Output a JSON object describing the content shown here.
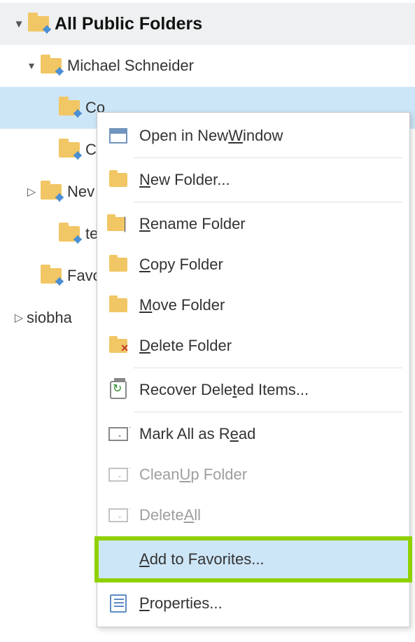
{
  "tree": {
    "root": "All Public Folders",
    "nodes": [
      {
        "label": "Michael Schneider",
        "level": 1,
        "arrow": "down"
      },
      {
        "label": "Co",
        "level": 2,
        "selected": true
      },
      {
        "label": "Co",
        "level": 2
      },
      {
        "label": "Nev",
        "level": 1,
        "arrow": "right"
      },
      {
        "label": "test",
        "level": 2
      },
      {
        "label": "Favo",
        "level": 1
      },
      {
        "label": "siobha",
        "level": 0,
        "arrow": "right",
        "plain": true
      }
    ]
  },
  "menu": {
    "items": [
      {
        "id": "open-new-window",
        "pre": "Open in New ",
        "u": "W",
        "post": "indow",
        "icon": "window"
      },
      {
        "id": "new-folder",
        "pre": "",
        "u": "N",
        "post": "ew Folder...",
        "icon": "folder",
        "sepBefore": true
      },
      {
        "id": "rename-folder",
        "pre": "",
        "u": "R",
        "post": "ename Folder",
        "icon": "folder-cursor",
        "sepBefore": true
      },
      {
        "id": "copy-folder",
        "pre": "",
        "u": "C",
        "post": "opy Folder",
        "icon": "folder"
      },
      {
        "id": "move-folder",
        "pre": "",
        "u": "M",
        "post": "ove Folder",
        "icon": "folder"
      },
      {
        "id": "delete-folder",
        "pre": "",
        "u": "D",
        "post": "elete Folder",
        "icon": "folder-x"
      },
      {
        "id": "recover-deleted",
        "pre": "Recover Dele",
        "u": "t",
        "post": "ed Items...",
        "icon": "recycle",
        "sepBefore": true
      },
      {
        "id": "mark-read",
        "pre": "Mark All as R",
        "u": "e",
        "post": "ad",
        "icon": "envelope",
        "sepBefore": true
      },
      {
        "id": "clean-up",
        "pre": "Clean ",
        "u": "U",
        "post": "p Folder",
        "icon": "envelope-gray",
        "disabled": true
      },
      {
        "id": "delete-all",
        "pre": "Delete ",
        "u": "A",
        "post": "ll",
        "icon": "envelope-gray",
        "disabled": true
      },
      {
        "id": "add-favorites",
        "pre": "",
        "u": "A",
        "post": "dd to Favorites...",
        "icon": "none",
        "hover": true,
        "sepBefore": true
      },
      {
        "id": "properties",
        "pre": "",
        "u": "P",
        "post": "roperties...",
        "icon": "props",
        "sepBefore": true
      }
    ]
  }
}
